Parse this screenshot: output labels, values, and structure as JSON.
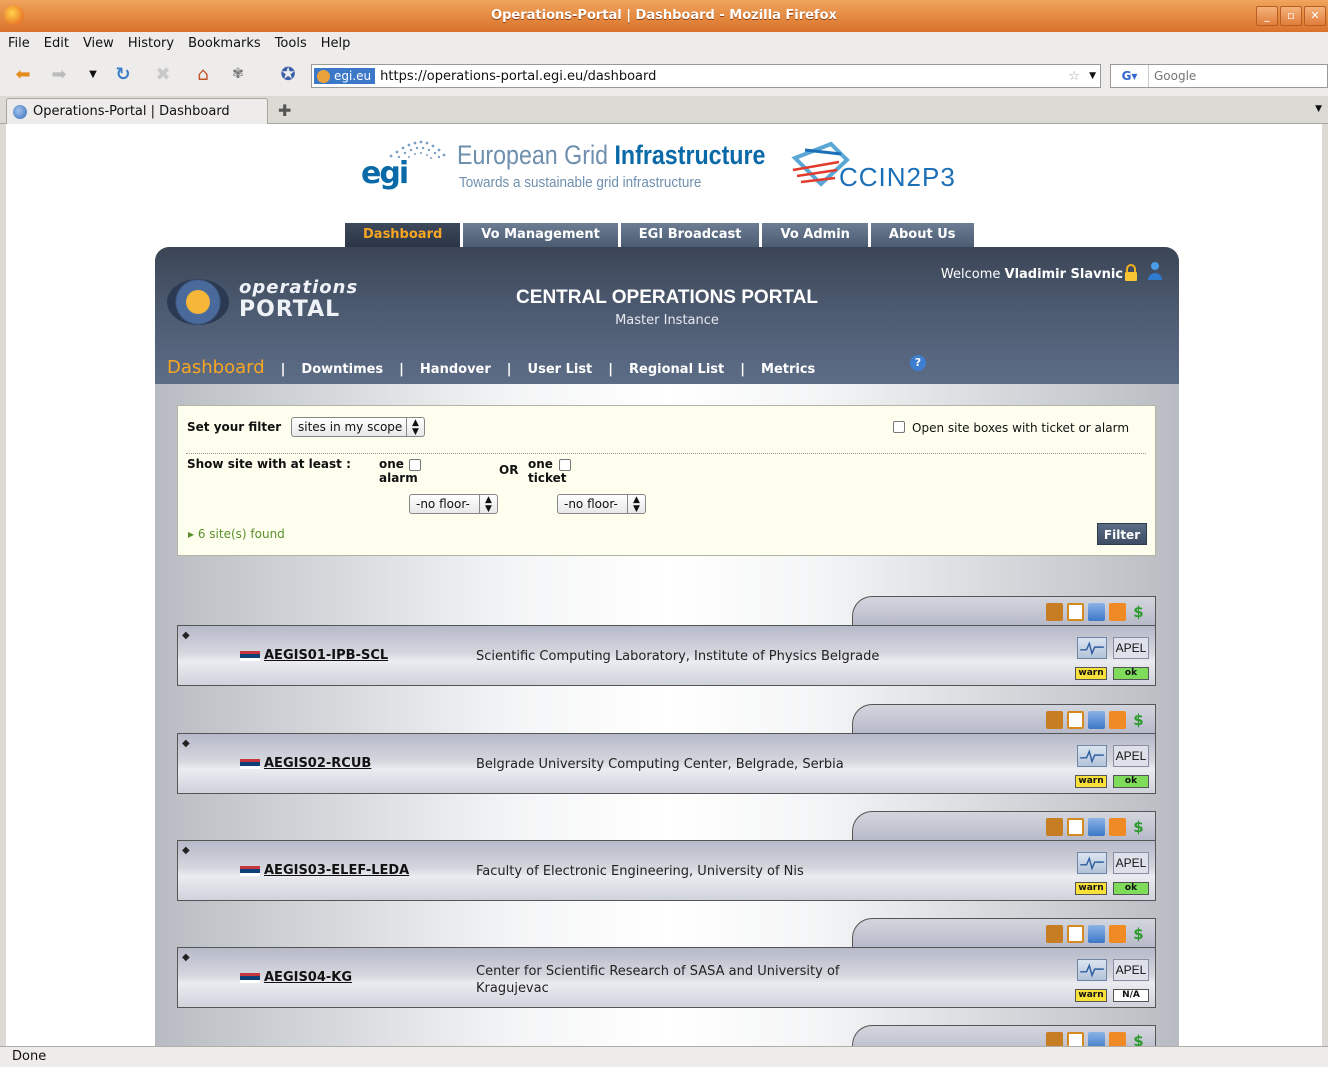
{
  "window": {
    "title": "Operations-Portal | Dashboard - Mozilla Firefox"
  },
  "menu": [
    "File",
    "Edit",
    "View",
    "History",
    "Bookmarks",
    "Tools",
    "Help"
  ],
  "navigation": {
    "identity": "egi.eu",
    "url": "https://operations-portal.egi.eu/dashboard",
    "search_placeholder": "Google"
  },
  "browser_tab": {
    "label": "Operations-Portal | Dashboard"
  },
  "status": "Done",
  "page": {
    "egi_title_light": "European Grid ",
    "egi_title_bold": "Infrastructure",
    "egi_mark": "egi",
    "egi_tagline": "Towards a sustainable grid infrastructure",
    "ccin2p3": "CCIN2P3",
    "top_tabs": [
      "Dashboard",
      "Vo Management",
      "EGI Broadcast",
      "Vo Admin",
      "About Us"
    ],
    "portal_logo_top": "operations",
    "portal_logo_bottom": "PORTAL",
    "portal_title": "CENTRAL OPERATIONS PORTAL",
    "portal_subtitle": "Master Instance",
    "welcome_prefix": "Welcome",
    "user_name": "Vladimir Slavnic",
    "sub_nav": [
      "Dashboard",
      "Downtimes",
      "Handover",
      "User List",
      "Regional List",
      "Metrics"
    ],
    "help": "?"
  },
  "filter": {
    "set_label": "Set your filter",
    "scope_value": "sites in my scope",
    "open_boxes_label": "Open site boxes with ticket or alarm",
    "show_label": "Show site with at least :",
    "one1": "one",
    "alarm": "alarm",
    "or": "OR",
    "one2": "one",
    "ticket": "ticket",
    "alarm_floor": "-no floor-",
    "ticket_floor": "-no floor-",
    "found": "6 site(s) found",
    "filter_button": "Filter"
  },
  "sites": [
    {
      "name": "AEGIS01-IPB-SCL",
      "description": "Scientific Computing Laboratory, Institute of Physics Belgrade",
      "apel": "APEL",
      "status1": "warn",
      "status2": "ok"
    },
    {
      "name": "AEGIS02-RCUB",
      "description": "Belgrade University Computing Center, Belgrade, Serbia",
      "apel": "APEL",
      "status1": "warn",
      "status2": "ok"
    },
    {
      "name": "AEGIS03-ELEF-LEDA",
      "description": "Faculty of Electronic Engineering, University of Nis",
      "apel": "APEL",
      "status1": "warn",
      "status2": "ok"
    },
    {
      "name": "AEGIS04-KG",
      "description": "Center for Scientific Research of SASA and University of Kragujevac",
      "apel": "APEL",
      "status1": "warn",
      "status2": "N/A"
    }
  ]
}
